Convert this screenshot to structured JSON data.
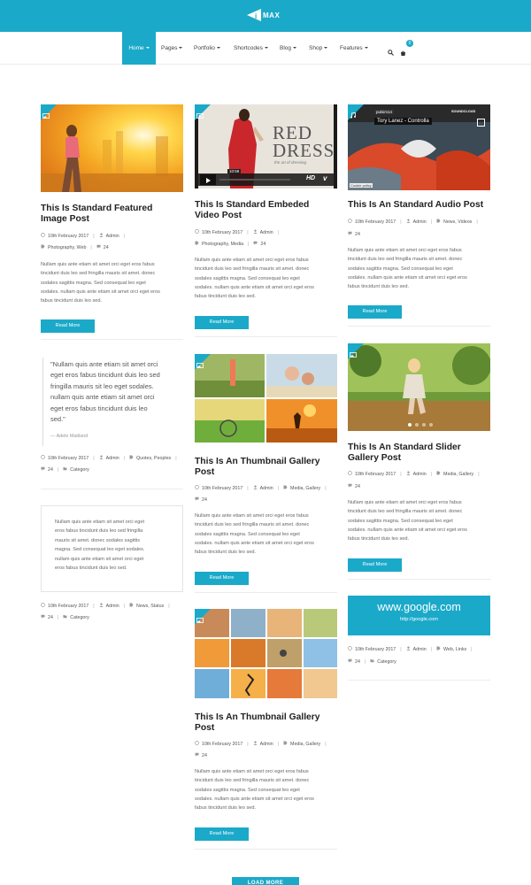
{
  "site": {
    "logo_text": "MAX",
    "accent": "#1ba9c9"
  },
  "nav": {
    "items": [
      {
        "label": "Home"
      },
      {
        "label": "Pages"
      },
      {
        "label": "Portfolio"
      },
      {
        "label": "Shortcodes"
      },
      {
        "label": "Blog"
      },
      {
        "label": "Shop"
      },
      {
        "label": "Features"
      }
    ],
    "cart_count": "0",
    "search_icon": "search-icon",
    "cart_icon": "cart-icon"
  },
  "posts": {
    "p1": {
      "title_line1": "This Is Standard Featured",
      "title_line2": "Image Post",
      "date": "10th February 2017",
      "author": "Admin",
      "categories": "Photography, Web",
      "comments": "24",
      "excerpt": [
        "Nullam quis ante etiam sit amet orci eget eros fabus",
        "tincidunt duis leo sed fringilla mauris sit amet. donec",
        "sodales sagittis magna. Sed consequat leo eget",
        "sodales. nullam quis ante etiam sit amet orci eget eros",
        "fabus tincidunt duis leo sed."
      ],
      "button": "Read More"
    },
    "p2": {
      "title_line1": "This Is Standard Embeded",
      "title_line2": "Video Post",
      "date": "10th February 2017",
      "author": "Admin",
      "categories": "Photography, Media",
      "comments": "24",
      "excerpt": [
        "Nullam quis ante etiam sit amet orci eget eros fabus",
        "tincidunt duis leo sed fringilla mauris sit amet. donec",
        "sodales sagittis magna. Sed consequat leo eget",
        "sodales. nullam quis ante etiam sit amet orci eget eros",
        "fabus tincidunt duis leo sed."
      ],
      "button": "Read More",
      "video_poster_title": "RED",
      "video_poster_title2": "DRESS",
      "video_poster_sub": "the art of dressing",
      "video_time": "10:59",
      "video_hd": "HD",
      "video_logo": "v"
    },
    "p3": {
      "title": "This Is An Standard Audio Post",
      "date": "10th February 2017",
      "author": "Admin",
      "categories": "News, Videos",
      "comments": "24",
      "excerpt": [
        "Nullam quis ante etiam sit amet orci eget eros fabus",
        "tincidunt duis leo sed fringilla mauris sit amet. donec",
        "sodales sagittis magna. Sed consequat leo eget",
        "sodales. nullam quis ante etiam sit amet orci eget eros",
        "fabus tincidunt duis leo sed."
      ],
      "button": "Read More",
      "audio_user": "pulsim14",
      "audio_track": "Tory Lanez - Controlla",
      "audio_brand": "SOUNDCLOUD",
      "cookie": "Cookie policy"
    },
    "quote": {
      "lines": [
        "\"Nullam quis ante etiam sit amet orci",
        "eget eros fabus tincidunt duis leo sed",
        "fringilla mauris sit leo eget sodales.",
        "nullam quis ante etiam sit amet orci",
        "eget eros fabus tincidunt duis leo",
        "sed.\""
      ],
      "author": "— Adele Maitland",
      "date": "10th February 2017",
      "by": "Admin",
      "categories": "Quotes, Peoples",
      "comments": "24",
      "category_label": "Category"
    },
    "gallery1": {
      "title_line1": "This Is An Thumbnail Gallery",
      "title_line2": "Post",
      "date": "10th February 2017",
      "author": "Admin",
      "categories": "Media, Gallery",
      "comments": "24",
      "excerpt": [
        "Nullam quis ante etiam sit amet orci eget eros fabus",
        "tincidunt duis leo sed fringilla mauris sit amet. donec",
        "sodales sagittis magna. Sed consequat leo eget",
        "sodales. nullam quis ante etiam sit amet orci eget eros",
        "fabus tincidunt duis leo sed."
      ],
      "button": "Read More"
    },
    "slider": {
      "title_line1": "This Is An Standard Slider",
      "title_line2": "Gallery Post",
      "date": "10th February 2017",
      "author": "Admin",
      "categories": "Media, Gallery",
      "comments": "24",
      "excerpt": [
        "Nullam quis ante etiam sit amet orci eget eros fabus",
        "tincidunt duis leo sed fringilla mauris sit amet. donec",
        "sodales sagittis magna. Sed consequat leo eget",
        "sodales. nullam quis ante etiam sit amet orci eget eros",
        "fabus tincidunt duis leo sed."
      ],
      "button": "Read More"
    },
    "status": {
      "lines": [
        "Nullam quis ante etiam sit amet orci eget",
        "eros fabus tincidunt duis leo sed fringilla",
        "mauris sit amet. donec sodales sagittis",
        "magna. Sed consequat leo eget sodales.",
        "nullam quis ante etiam sit amet orci eget",
        "eros fabus tincidunt duis leo sed."
      ],
      "date": "10th February 2017",
      "author": "Admin",
      "categories": "News, Status",
      "comments": "24",
      "category_label": "Category"
    },
    "link": {
      "big": "www.google.com",
      "small": "http://google.com",
      "date": "10th February 2017",
      "author": "Admin",
      "categories": "Web, Links",
      "comments": "24",
      "category_label": "Category"
    },
    "gallery2": {
      "title_line1": "This Is An Thumbnail Gallery",
      "title_line2": "Post",
      "date": "10th February 2017",
      "author": "Admin",
      "categories": "Media, Gallery",
      "comments": "24",
      "excerpt": [
        "Nullam quis ante etiam sit amet orci eget eros fabus",
        "tincidunt duis leo sed fringilla mauris sit amet. donec",
        "sodales sagittis magna. Sed consequat leo eget",
        "sodales. nullam quis ante etiam sit amet orci eget eros",
        "fabus tincidunt duis leo sed."
      ],
      "button": "Read More"
    }
  },
  "load_more": "LOAD MORE"
}
